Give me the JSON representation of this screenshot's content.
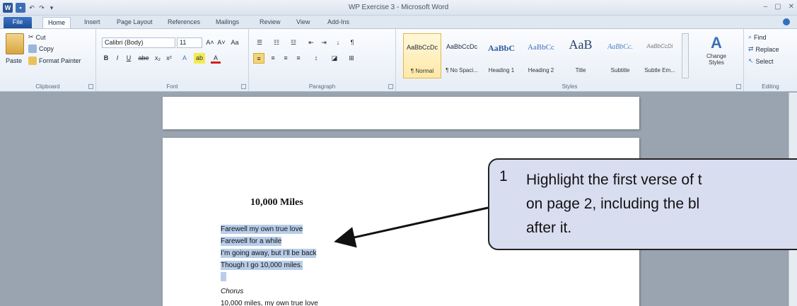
{
  "window": {
    "title": "WP Exercise 3 - Microsoft Word",
    "controls": [
      "–",
      "▢",
      "✕"
    ]
  },
  "qat": {
    "word_glyph": "W",
    "undo_glyph": "↶",
    "redo_glyph": "↷",
    "more_glyph": "▾"
  },
  "tabs": [
    "File",
    "Home",
    "Insert",
    "Page Layout",
    "References",
    "Mailings",
    "Review",
    "View",
    "Add-Ins"
  ],
  "active_tab": "Home",
  "ribbon": {
    "clipboard": {
      "label": "Clipboard",
      "paste": "Paste",
      "cut": "Cut",
      "copy": "Copy",
      "format_painter": "Format Painter"
    },
    "font": {
      "label": "Font",
      "font_name": "Calibri (Body)",
      "font_size": "11",
      "bold": "B",
      "italic": "I",
      "underline": "U",
      "strike": "abe",
      "sub": "x₂",
      "sup": "x²",
      "grow": "A˄",
      "shrink": "A˅",
      "case": "Aa",
      "clear": "🖌",
      "text_effects": "A",
      "highlight": "ab",
      "font_color": "A"
    },
    "paragraph": {
      "label": "Paragraph"
    },
    "styles": {
      "label": "Styles",
      "items": [
        {
          "sample": "AaBbCcDc",
          "name": "¶ Normal"
        },
        {
          "sample": "AaBbCcDc",
          "name": "¶ No Spaci..."
        },
        {
          "sample": "AaBbC",
          "name": "Heading 1"
        },
        {
          "sample": "AaBbCc",
          "name": "Heading 2"
        },
        {
          "sample": "AaB",
          "name": "Title"
        },
        {
          "sample": "AaBbCc.",
          "name": "Subtitle"
        },
        {
          "sample": "AaBbCcDi",
          "name": "Subtle Em..."
        }
      ],
      "change_styles": "Change Styles"
    },
    "editing": {
      "label": "Editing",
      "find": "Find",
      "replace": "Replace",
      "select": "Select"
    }
  },
  "document": {
    "title": "10,000 Miles",
    "verse": [
      "Farewell my own true love",
      "Farewell for a while",
      "I’m going away, but I’ll be back",
      "Though I go 10,000 miles."
    ],
    "chorus_label": "Chorus",
    "chorus_first_line": "10,000 miles, my own true love"
  },
  "callout": {
    "number": "1",
    "lines": [
      "Highlight the first verse of t",
      "on page 2, including the bl",
      "after it."
    ]
  },
  "colors": {
    "selection": "#b8cde9",
    "callout_bg": "#d9ddf0",
    "file_tab": "#2b5797"
  }
}
